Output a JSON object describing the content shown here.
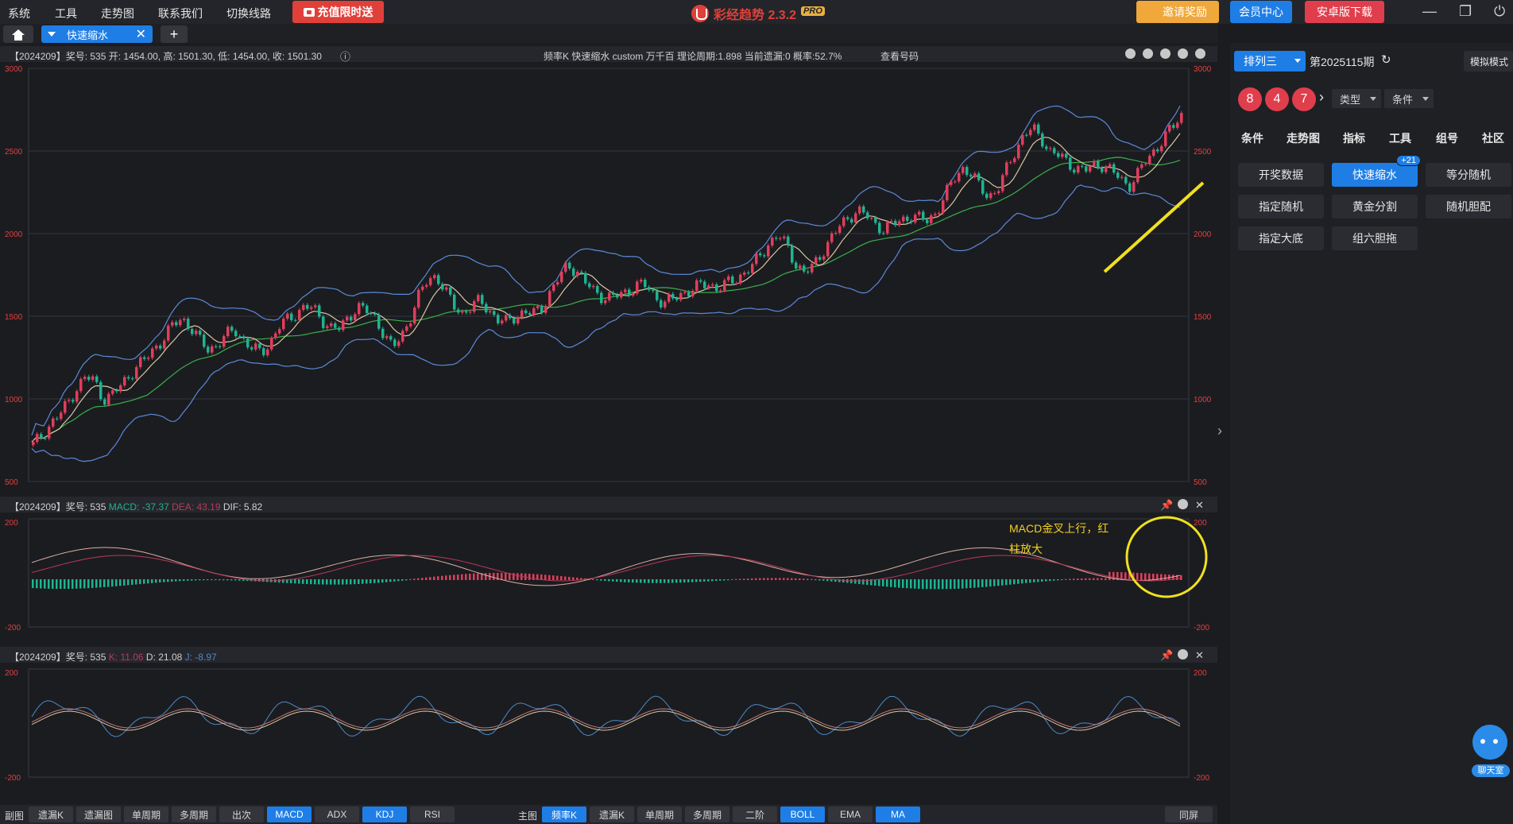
{
  "menu": [
    "系统",
    "工具",
    "走势图",
    "联系我们",
    "切换线路"
  ],
  "promo": "充值限时送",
  "app": {
    "title": "彩经趋势 2.3.2",
    "badge": "PRO"
  },
  "top_buttons": {
    "invite": "邀请奖励",
    "member": "会员中心",
    "android": "安卓版下载"
  },
  "tabs": {
    "active": "快速缩水"
  },
  "main_panel": {
    "info": "【2024209】奖号: 535  开: 1454.00, 高: 1501.30, 低: 1454.00, 收: 1501.30",
    "params": "频率K  快速缩水  custom  万千百  理论周期:1.898  当前遗漏:0  概率:52.7%",
    "query": "查看号码",
    "y_ticks": [
      "3000",
      "2500",
      "2000",
      "1500",
      "1000",
      "500"
    ]
  },
  "macd_panel": {
    "prefix": "【2024209】奖号: 535",
    "macd": "MACD: -37.37",
    "dea": "DEA: 43.19",
    "dif": "DIF: 5.82",
    "y_ticks": [
      "200",
      "-200"
    ],
    "annotation_line1": "MACD金叉上行，红",
    "annotation_line2": "柱放大"
  },
  "kdj_panel": {
    "prefix": "【2024209】奖号: 535",
    "k": "K: 11.06",
    "d": "D: 21.08",
    "j": "J: -8.97",
    "y_ticks": [
      "200",
      "-200"
    ]
  },
  "sidebar": {
    "lottery": "排列三",
    "issue": "第2025115期",
    "mode": "模拟模式",
    "balls": [
      "8",
      "4",
      "7"
    ],
    "type_dd": "类型",
    "cond_dd": "条件",
    "nav": [
      "条件",
      "走势图",
      "指标",
      "工具",
      "组号",
      "社区"
    ],
    "tools": [
      "开奖数据",
      "快速缩水",
      "等分随机",
      "指定随机",
      "黄金分割",
      "随机胆配",
      "指定大底",
      "组六胆拖"
    ],
    "badge": "+21"
  },
  "bottom": {
    "sub_label": "副图",
    "sub_buttons": [
      "遗漏K",
      "遗漏图",
      "单周期",
      "多周期",
      "出次",
      "MACD",
      "ADX",
      "KDJ",
      "RSI"
    ],
    "main_label": "主图",
    "main_buttons": [
      "频率K",
      "遗漏K",
      "单周期",
      "多周期",
      "二阶",
      "BOLL",
      "EMA",
      "MA"
    ],
    "sync": "同屏"
  },
  "chat": "聊天室",
  "colors": {
    "accent": "#1e7ee6",
    "red": "#e03e4c",
    "green": "#1fb391",
    "yellow": "#f0e020"
  },
  "chart_data": {
    "type": "candlestick",
    "ylim": [
      500,
      3000
    ],
    "close": [
      720,
      780,
      850,
      900,
      980,
      1070,
      1130,
      1110,
      1000,
      1020,
      1080,
      1150,
      1200,
      1250,
      1320,
      1370,
      1450,
      1490,
      1430,
      1350,
      1300,
      1330,
      1380,
      1420,
      1360,
      1300,
      1280,
      1340,
      1430,
      1480,
      1520,
      1560,
      1540,
      1480,
      1430,
      1420,
      1500,
      1560,
      1530,
      1490,
      1400,
      1300,
      1380,
      1490,
      1620,
      1720,
      1750,
      1650,
      1560,
      1520,
      1560,
      1590,
      1540,
      1480,
      1460,
      1500,
      1530,
      1510,
      1550,
      1650,
      1730,
      1810,
      1780,
      1700,
      1650,
      1620,
      1610,
      1630,
      1660,
      1690,
      1680,
      1620,
      1580,
      1600,
      1640,
      1660,
      1680,
      1700,
      1670,
      1690,
      1720,
      1760,
      1800,
      1870,
      1950,
      1990,
      1920,
      1820,
      1760,
      1800,
      1890,
      1970,
      2040,
      2100,
      2140,
      2110,
      2060,
      2030,
      2050,
      2080,
      2110,
      2090,
      2080,
      2130,
      2220,
      2330,
      2400,
      2360,
      2280,
      2230,
      2260,
      2380,
      2500,
      2600,
      2630,
      2580,
      2500,
      2470,
      2430,
      2400,
      2380,
      2410,
      2420,
      2380,
      2330,
      2290,
      2360,
      2440,
      2510,
      2580,
      2640,
      2720
    ]
  }
}
